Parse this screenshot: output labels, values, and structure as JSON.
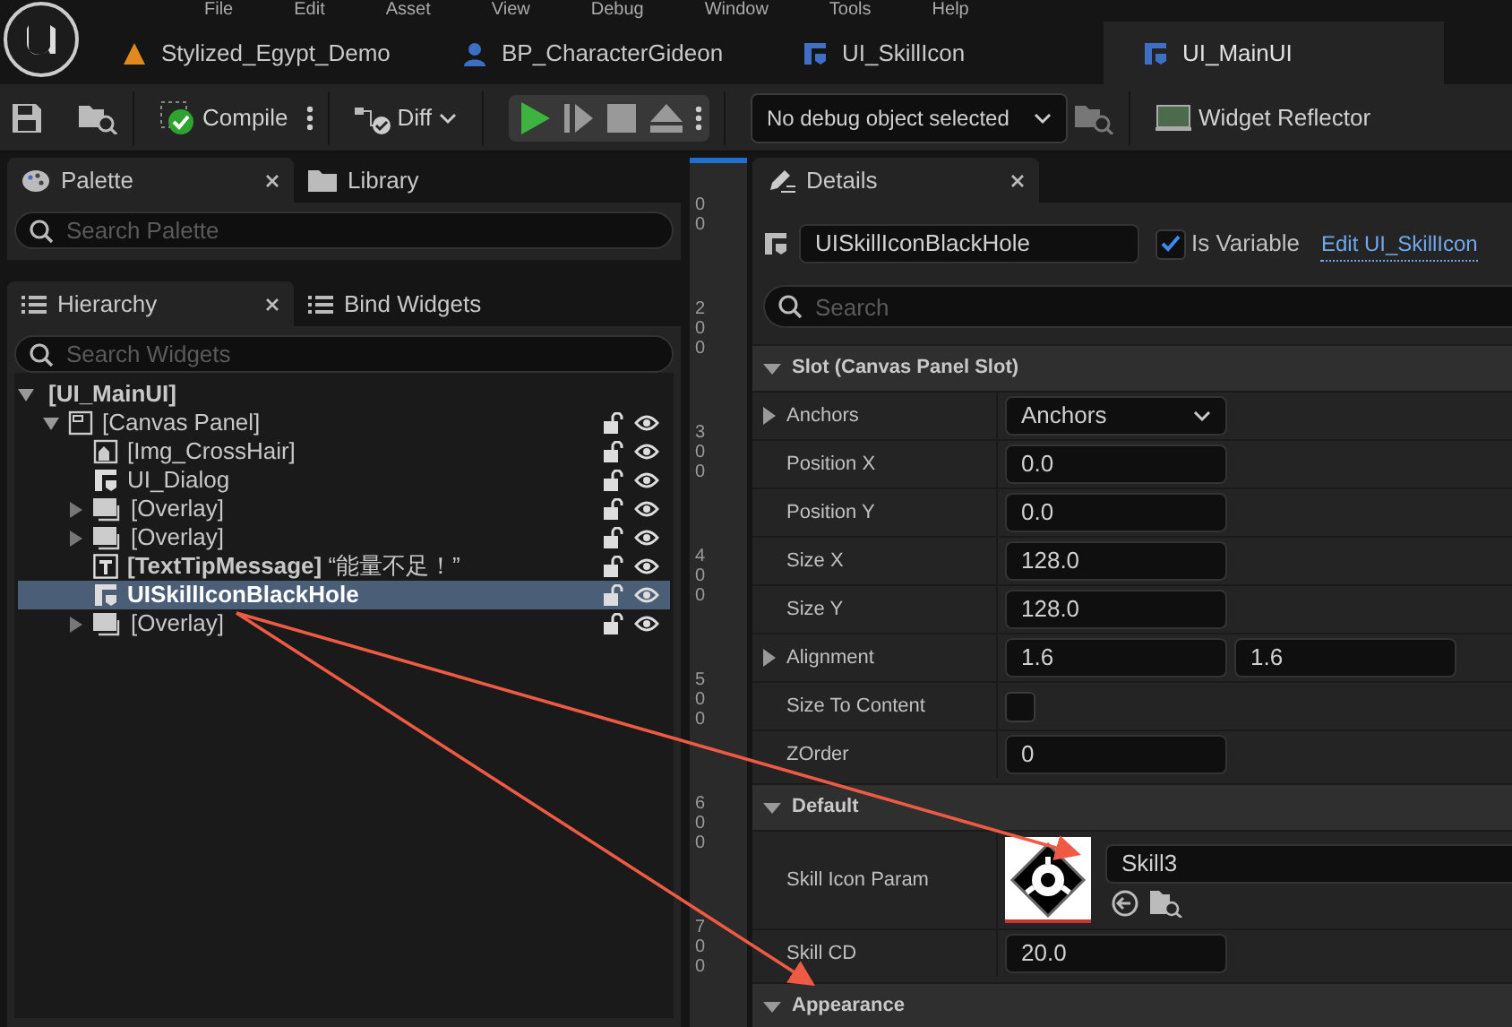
{
  "menu": [
    "File",
    "Edit",
    "Asset",
    "View",
    "Debug",
    "Window",
    "Tools",
    "Help"
  ],
  "document_tabs": [
    {
      "label": "Stylized_Egypt_Demo",
      "kind": "level",
      "selected": false
    },
    {
      "label": "BP_CharacterGideon",
      "kind": "blueprint",
      "selected": false
    },
    {
      "label": "UI_SkillIcon",
      "kind": "widget",
      "selected": false
    },
    {
      "label": "UI_MainUI",
      "kind": "widget",
      "selected": true
    }
  ],
  "toolbar": {
    "compile": "Compile",
    "diff": "Diff",
    "debug_select": "No debug object selected",
    "widget_reflector": "Widget Reflector"
  },
  "palette_panel": {
    "tabs": [
      {
        "label": "Palette",
        "kind": "palette",
        "selected": true
      },
      {
        "label": "Library",
        "kind": "folder",
        "selected": false
      }
    ],
    "search": {
      "placeholder": "Search Palette"
    }
  },
  "hierarchy_panel": {
    "tabs": [
      {
        "label": "Hierarchy",
        "kind": "list",
        "selected": true
      },
      {
        "label": "Bind Widgets",
        "kind": "list",
        "selected": false
      }
    ],
    "search": {
      "placeholder": "Search Widgets"
    },
    "tree": [
      {
        "label": "[UI_MainUI]",
        "kind": "root",
        "expanded": true,
        "selected": false,
        "children": [
          {
            "label": "[Canvas Panel]",
            "kind": "canvas",
            "expanded": true,
            "selected": false,
            "children": [
              {
                "label": "[Img_CrossHair]",
                "kind": "image",
                "selected": false
              },
              {
                "label": "UI_Dialog",
                "kind": "user_widget",
                "selected": false
              },
              {
                "label": "[Overlay]",
                "kind": "overlay",
                "expanded": false,
                "selected": false
              },
              {
                "label": "[Overlay]",
                "kind": "overlay",
                "expanded": false,
                "selected": false
              },
              {
                "label": "**[TextTipMessage]** “能量不足！”",
                "kind": "text",
                "selected": false
              },
              {
                "label": "UISkillIconBlackHole",
                "kind": "user_widget",
                "selected": true
              },
              {
                "label": "[Overlay]",
                "kind": "overlay",
                "expanded": false,
                "selected": false
              }
            ]
          }
        ]
      }
    ]
  },
  "ruler": {
    "labels": [
      "00",
      "200",
      "300",
      "400",
      "500",
      "600",
      "700"
    ]
  },
  "details": {
    "tab": "Details",
    "name_field": "UISkillIconBlackHole",
    "is_variable": {
      "label": "Is Variable",
      "checked": true
    },
    "edit_link": "Edit UI_SkillIcon",
    "search": {
      "placeholder": "Search"
    },
    "sections": [
      {
        "title": "Slot (Canvas Panel Slot)",
        "expanded": true,
        "rows": [
          {
            "label": "Anchors",
            "kind": "dropdown",
            "expandable": true,
            "value": "Anchors"
          },
          {
            "label": "Position X",
            "kind": "number",
            "value": "0.0"
          },
          {
            "label": "Position Y",
            "kind": "number",
            "value": "0.0"
          },
          {
            "label": "Size X",
            "kind": "number",
            "value": "128.0"
          },
          {
            "label": "Size Y",
            "kind": "number",
            "value": "128.0"
          },
          {
            "label": "Alignment",
            "kind": "pair",
            "expandable": true,
            "values": [
              "1.6",
              "1.6"
            ]
          },
          {
            "label": "Size To Content",
            "kind": "checkbox",
            "checked": false
          },
          {
            "label": "ZOrder",
            "kind": "number",
            "value": "0"
          }
        ]
      },
      {
        "title": "Default",
        "expanded": true,
        "rows": [
          {
            "label": "Skill Icon Param",
            "kind": "asset",
            "value": "Skill3"
          },
          {
            "label": "Skill CD",
            "kind": "number",
            "value": "20.0"
          }
        ]
      },
      {
        "title": "Appearance",
        "expanded": true
      }
    ]
  }
}
